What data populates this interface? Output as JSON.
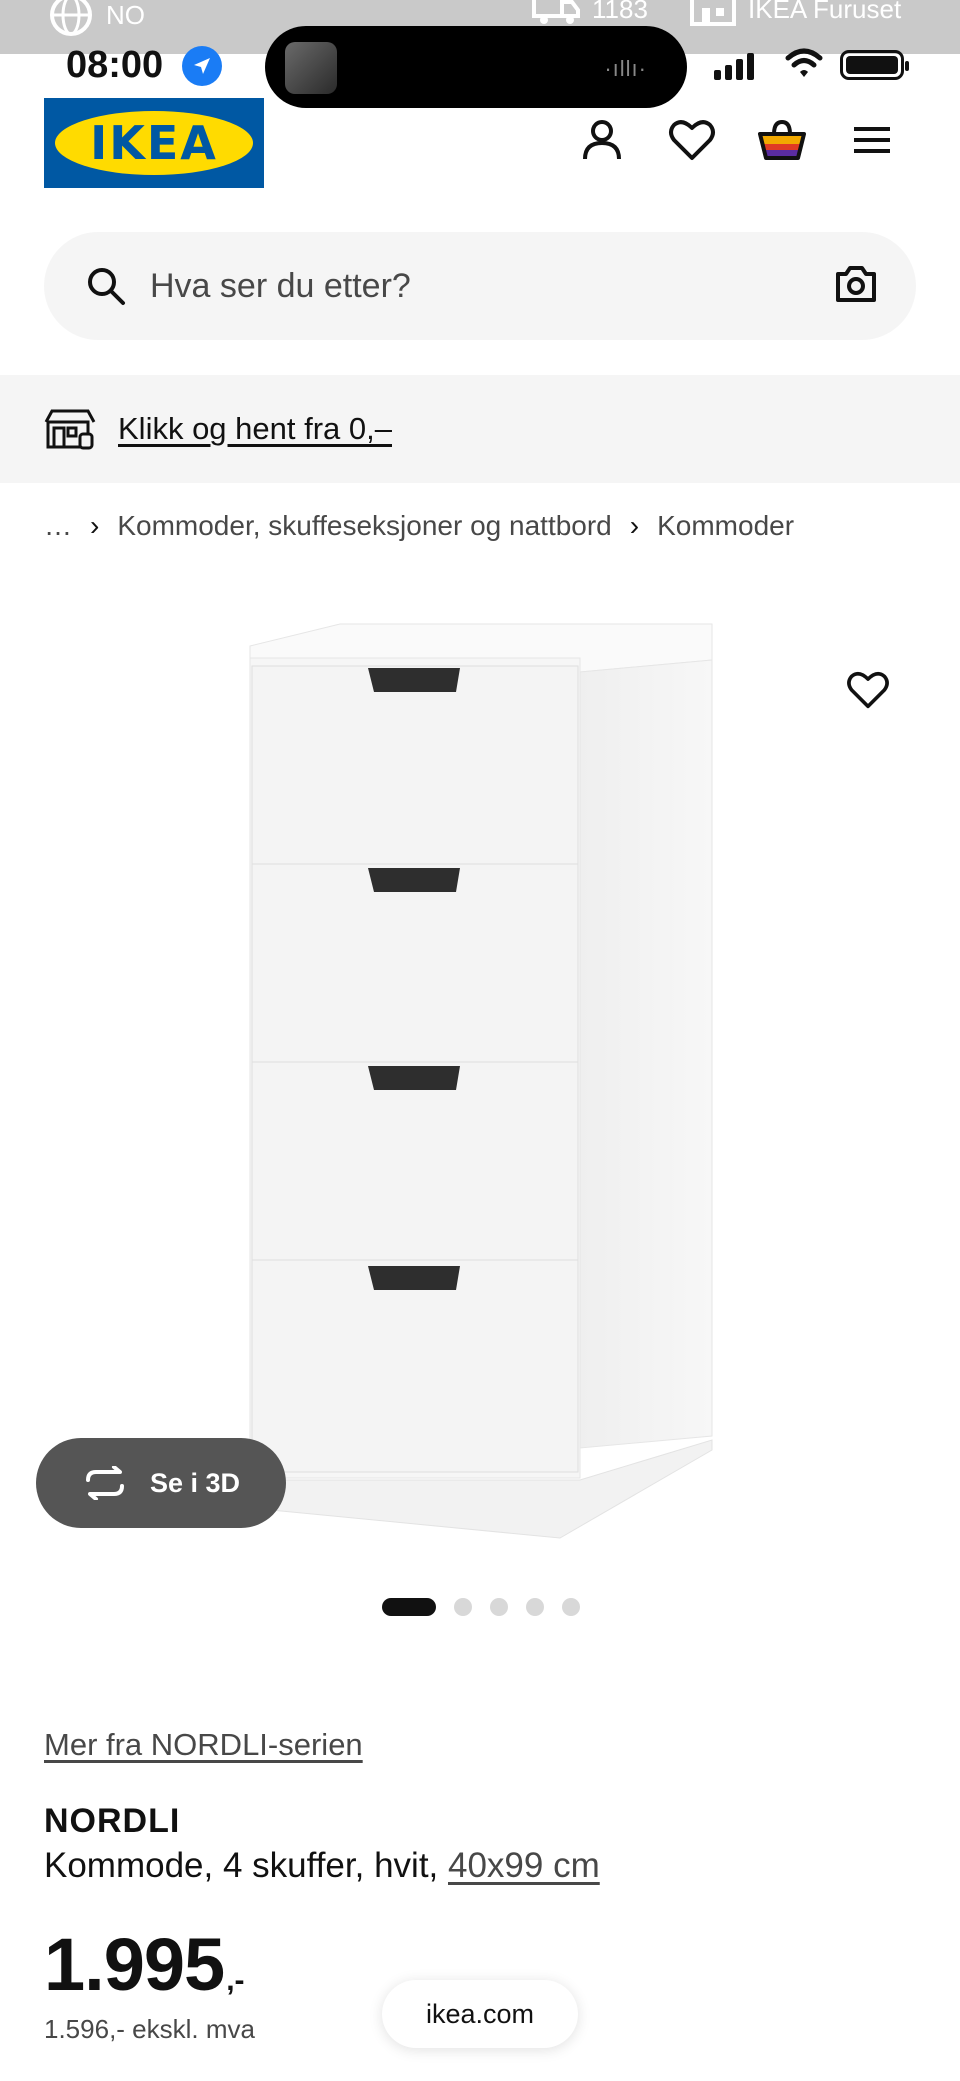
{
  "ghost_bar": {
    "language": "NO",
    "store_hours_partial": "1183",
    "store_name": "IKEA Furuset"
  },
  "status_bar": {
    "time": "08:00"
  },
  "header": {
    "logo_text": "IKEA",
    "icons": [
      "account-icon",
      "heart-icon",
      "shopping-bag-icon",
      "menu-icon"
    ]
  },
  "search": {
    "placeholder": "Hva ser du etter?"
  },
  "promo": {
    "text": "Klikk og hent fra 0,–"
  },
  "breadcrumb": {
    "ellipsis": "…",
    "items": [
      "Kommoder, skuffeseksjoner og nattbord",
      "Kommoder"
    ]
  },
  "gallery": {
    "view_3d_label": "Se i 3D",
    "dot_count": 5,
    "active_index": 0
  },
  "product": {
    "series_link": "Mer fra NORDLI-serien",
    "name": "NORDLI",
    "description": "Kommode, 4 skuffer, hvit, ",
    "size_link": "40x99 cm",
    "price_main": "1.995",
    "price_suffix": ",-",
    "price_ex_vat": "1.596,- ekskl. mva"
  },
  "browser": {
    "url": "ikea.com"
  },
  "colors": {
    "ikea_blue": "#0058a3",
    "ikea_yellow": "#ffdb00",
    "text_dark": "#111111",
    "text_grey": "#484848",
    "band_grey": "#f5f5f5"
  }
}
